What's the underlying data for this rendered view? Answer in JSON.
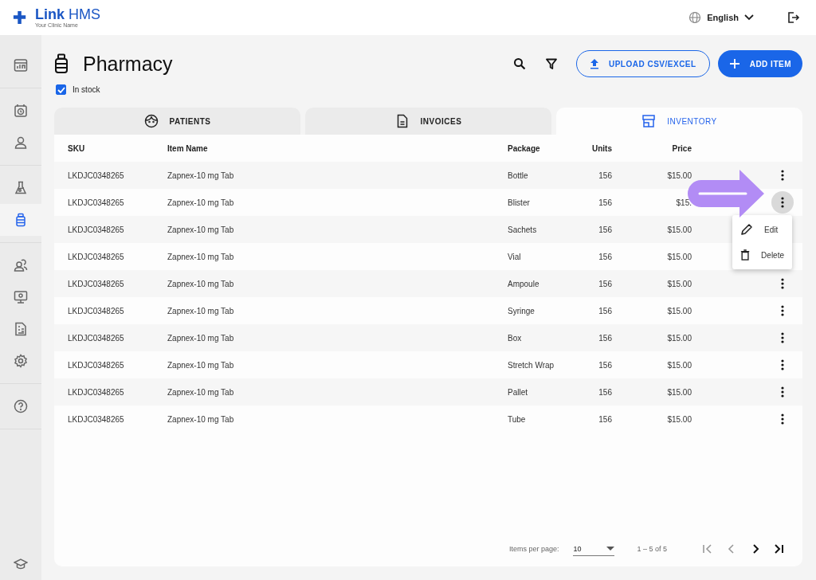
{
  "header": {
    "brand": "**Link** HMS",
    "subtitle": "Your Clinic Name",
    "language": "English"
  },
  "sidebar": {
    "groups": [
      {
        "items": [
          {
            "selected": false
          }
        ]
      },
      {
        "items": [
          {
            "selected": false
          },
          {
            "selected": false
          }
        ]
      },
      {
        "items": [
          {
            "selected": false
          },
          {
            "selected": true
          }
        ]
      },
      {
        "items": [
          {
            "selected": false
          },
          {
            "selected": false
          },
          {
            "selected": false
          },
          {
            "selected": false
          }
        ]
      },
      {
        "items": [
          {
            "selected": false
          }
        ]
      }
    ],
    "bottom_items": [
      {
        "selected": false
      }
    ]
  },
  "page": {
    "title": "Pharmacy",
    "upload_button": "UPLOAD CSV/EXCEL",
    "add_button": "ADD ITEM"
  },
  "filter": {
    "label": "In stock",
    "checked": true
  },
  "tabs": [
    {
      "label": "PATIENTS",
      "selected": false
    },
    {
      "label": "INVOICES",
      "selected": false
    },
    {
      "label": "INVENTORY",
      "selected": true
    }
  ],
  "table": {
    "columns": [
      "SKU",
      "Item Name",
      "Package",
      "Units",
      "Price"
    ],
    "rows": [
      {
        "sku": "LKDJC0348265",
        "name": "Zapnex-10 mg Tab",
        "package": "Bottle",
        "units": "156",
        "price": "$15.00",
        "menu_open": false
      },
      {
        "sku": "LKDJC0348265",
        "name": "Zapnex-10 mg Tab",
        "package": "Blister",
        "units": "156",
        "price": "$15.",
        "menu_open": true
      },
      {
        "sku": "LKDJC0348265",
        "name": "Zapnex-10 mg Tab",
        "package": "Sachets",
        "units": "156",
        "price": "$15.00",
        "menu_open": false
      },
      {
        "sku": "LKDJC0348265",
        "name": "Zapnex-10 mg Tab",
        "package": "Vial",
        "units": "156",
        "price": "$15.00",
        "menu_open": false
      },
      {
        "sku": "LKDJC0348265",
        "name": "Zapnex-10 mg Tab",
        "package": "Ampoule",
        "units": "156",
        "price": "$15.00",
        "menu_open": false
      },
      {
        "sku": "LKDJC0348265",
        "name": "Zapnex-10 mg Tab",
        "package": "Syringe",
        "units": "156",
        "price": "$15.00",
        "menu_open": false
      },
      {
        "sku": "LKDJC0348265",
        "name": "Zapnex-10 mg Tab",
        "package": "Box",
        "units": "156",
        "price": "$15.00",
        "menu_open": false
      },
      {
        "sku": "LKDJC0348265",
        "name": "Zapnex-10 mg Tab",
        "package": "Stretch Wrap",
        "units": "156",
        "price": "$15.00",
        "menu_open": false
      },
      {
        "sku": "LKDJC0348265",
        "name": "Zapnex-10 mg Tab",
        "package": "Pallet",
        "units": "156",
        "price": "$15.00",
        "menu_open": false
      },
      {
        "sku": "LKDJC0348265",
        "name": "Zapnex-10 mg Tab",
        "package": "Tube",
        "units": "156",
        "price": "$15.00",
        "menu_open": false
      }
    ]
  },
  "row_menu": [
    {
      "kind": "edit",
      "label": "Edit"
    },
    {
      "kind": "delete",
      "label": "Delete"
    }
  ],
  "pagination": {
    "label": "Items per page:",
    "page_size": "10",
    "range": "1 – 5 of 5",
    "nav": [
      {
        "kind": "first",
        "disabled": true
      },
      {
        "kind": "prev",
        "disabled": true
      },
      {
        "kind": "next",
        "disabled": false
      },
      {
        "kind": "last",
        "disabled": false
      }
    ]
  }
}
